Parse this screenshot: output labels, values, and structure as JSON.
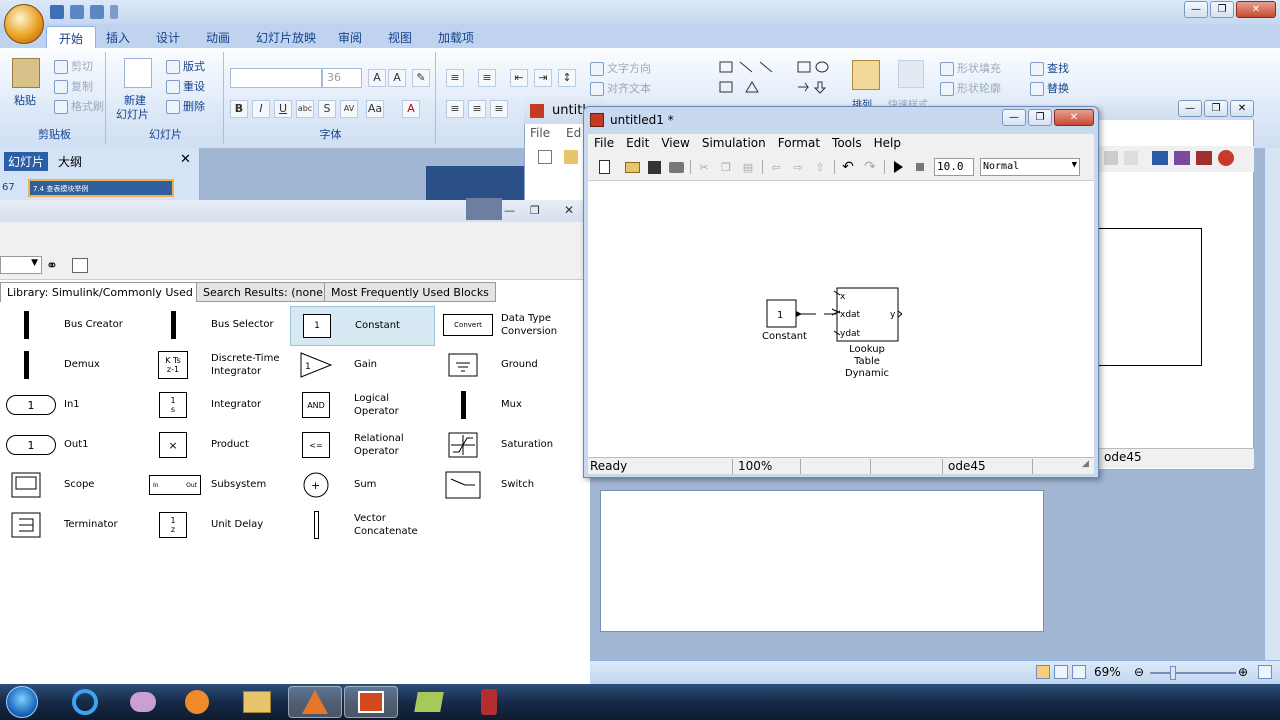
{
  "ppt": {
    "tabs": [
      "开始",
      "插入",
      "设计",
      "动画",
      "幻灯片放映",
      "审阅",
      "视图",
      "加载项"
    ],
    "clipboard": {
      "paste": "粘贴",
      "cut": "剪切",
      "copy": "复制",
      "format_painter": "格式刷",
      "group": "剪贴板"
    },
    "slides": {
      "new_slide_l1": "新建",
      "new_slide_l2": "幻灯片",
      "layout": "版式",
      "reset": "重设",
      "delete": "删除",
      "group": "幻灯片"
    },
    "font": {
      "size": "36",
      "group": "字体"
    },
    "paragraph": {
      "text_direction": "文字方向",
      "align_text": "对齐文本"
    },
    "drawing": {
      "shape_fill": "形状填充",
      "shape_outline": "形状轮廓",
      "arrange": "排列",
      "quick_styles": "快速样式"
    },
    "editing": {
      "find": "查找",
      "replace": "替换"
    },
    "panel": {
      "tab_slides": "幻灯片",
      "tab_outline": "大纲",
      "slide_number": "67",
      "slide_thumb_text": "7.4 查表模块举例"
    },
    "zoom": "69%"
  },
  "library": {
    "tabs": [
      "Library: Simulink/Commonly Used Blocks",
      "Search Results: (none)",
      "Most Frequently Used Blocks"
    ],
    "blocks": [
      [
        "Bus Creator",
        "Bus Selector",
        "Constant",
        "Data Type Conversion"
      ],
      [
        "Demux",
        "Discrete-Time Integrator",
        "Gain",
        "Ground"
      ],
      [
        "In1",
        "Integrator",
        "Logical Operator",
        "Mux"
      ],
      [
        "Out1",
        "Product",
        "Relational Operator",
        "Saturation"
      ],
      [
        "Scope",
        "Subsystem",
        "Sum",
        "Switch"
      ],
      [
        "Terminator",
        "Unit Delay",
        "Vector Concatenate",
        ""
      ]
    ],
    "sym": {
      "constant": "1",
      "kts": "K Ts",
      "z1": "z-1",
      "int_num": "1",
      "int_den": "s",
      "and": "AND",
      "rel": "<=",
      "product": "×",
      "in": "1",
      "out": "1",
      "gain": "1",
      "convert": "Convert",
      "ud_num": "1",
      "ud_den": "z",
      "sub_in": "In",
      "sub_out": "Out"
    }
  },
  "simwin": {
    "title": "untitled1 *",
    "menu": [
      "File",
      "Edit",
      "View",
      "Simulation",
      "Format",
      "Tools",
      "Help"
    ],
    "stop_time": "10.0",
    "sim_mode": "Normal",
    "status": {
      "left": "Ready",
      "zoom": "100%",
      "solver": "ode45"
    },
    "model": {
      "constant_value": "1",
      "constant_label": "Constant",
      "lookup_ports": [
        "x",
        "xdat",
        "ydat"
      ],
      "lookup_out": "y",
      "lookup_label": [
        "Lookup",
        "Table",
        "Dynamic"
      ]
    }
  },
  "midwin": {
    "title": "untitl",
    "menu": [
      "File",
      "Ed"
    ]
  },
  "rightwin": {
    "solver": "ode45"
  }
}
